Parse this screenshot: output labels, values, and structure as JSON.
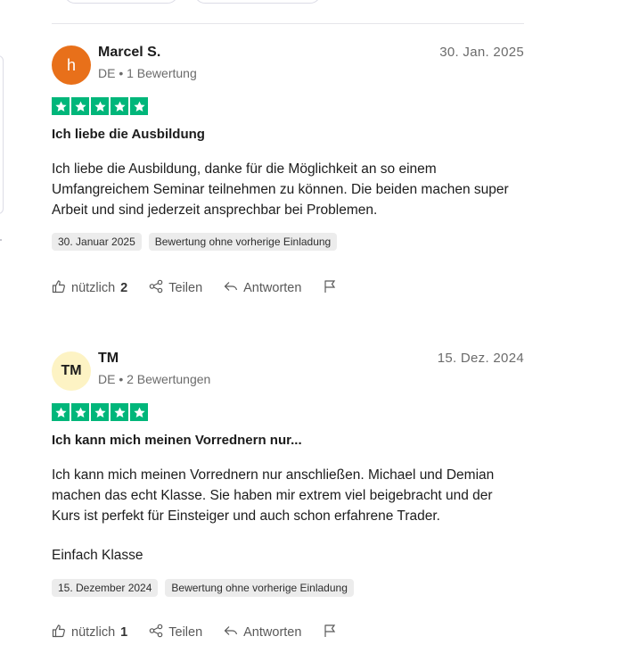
{
  "reviews": [
    {
      "avatar_initials": "h",
      "avatar_color": "#e8701a",
      "avatar_text_color": "#ffffff",
      "name": "Marcel S.",
      "meta": "DE • 1 Bewertung",
      "date": "30. Jan. 2025",
      "rating": 5,
      "title": "Ich liebe die Ausbildung",
      "body": [
        "Ich liebe die Ausbildung, danke für die Möglichkeit an so einem Umfangreichem Seminar teilnehmen zu können. Die beiden machen super Arbeit und sind jederzeit ansprechbar bei Problemen."
      ],
      "tags": [
        "30. Januar 2025",
        "Bewertung ohne vorherige Einladung"
      ],
      "actions": {
        "useful_label": "nützlich",
        "useful_count": "2",
        "share_label": "Teilen",
        "reply_label": "Antworten"
      }
    },
    {
      "avatar_initials": "TM",
      "avatar_color": "#fdf3c4",
      "avatar_text_color": "#1c1c1c",
      "name": "TM",
      "meta": "DE • 2 Bewertungen",
      "date": "15. Dez. 2024",
      "rating": 5,
      "title": "Ich kann mich meinen Vorrednern nur...",
      "body": [
        "Ich kann mich meinen Vorrednern nur anschließen. Michael und Demian machen das echt Klasse. Sie haben mir extrem viel beigebracht und der Kurs ist perfekt für Einsteiger und auch schon erfahrene Trader.",
        "Einfach Klasse"
      ],
      "tags": [
        "15. Dezember 2024",
        "Bewertung ohne vorherige Einladung"
      ],
      "actions": {
        "useful_label": "nützlich",
        "useful_count": "1",
        "share_label": "Teilen",
        "reply_label": "Antworten"
      }
    }
  ],
  "colors": {
    "star_green": "#00b67a"
  },
  "icons": {
    "useful": "thumbs-up-icon",
    "share": "share-icon",
    "reply": "reply-icon",
    "flag": "flag-icon",
    "star": "star-icon"
  }
}
